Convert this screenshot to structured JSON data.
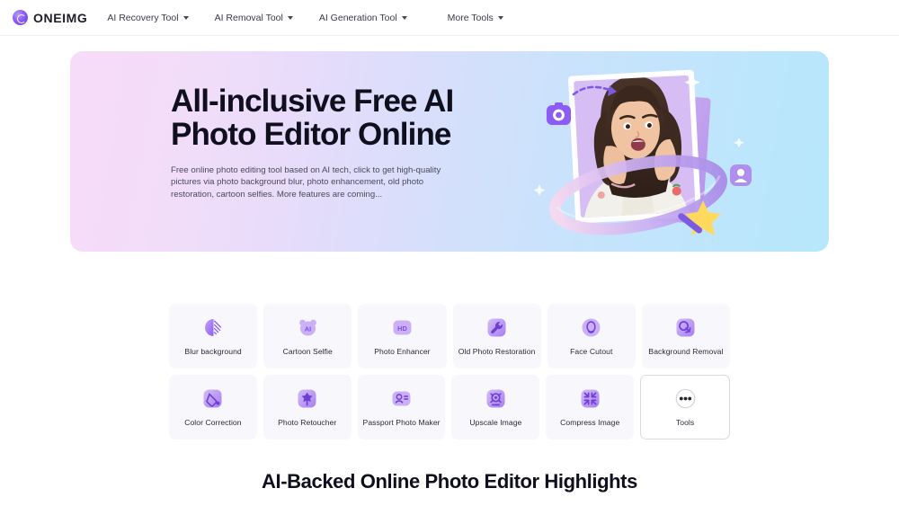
{
  "header": {
    "logo": {
      "icon": "oneimg-logo-icon",
      "text": "ONEIMG"
    },
    "nav": [
      {
        "label": "AI Recovery Tool",
        "caret": "chevron-down-icon"
      },
      {
        "label": "AI Removal Tool",
        "caret": "chevron-down-icon"
      },
      {
        "label": "AI Generation Tool",
        "caret": "chevron-down-icon"
      },
      {
        "label": "More Tools",
        "caret": "chevron-down-icon"
      }
    ]
  },
  "hero": {
    "title_line1": "All-inclusive Free AI",
    "title_line2": "Photo Editor Online",
    "subtitle": "Free online photo editing tool based on AI tech, click to get high-quality pictures via photo background blur, photo enhancement, old photo restoration, cartoon selfies. More features are coming...",
    "gradient_start": "#f7dcf8",
    "gradient_end": "#b6e7fb",
    "illustration": "woman-photo-frame-illustration"
  },
  "tools": {
    "row1": [
      {
        "label": "Blur background",
        "icon": "blur-background-icon"
      },
      {
        "label": "Cartoon Selfie",
        "icon": "cartoon-selfie-ai-icon"
      },
      {
        "label": "Photo Enhancer",
        "icon": "hd-photo-enhancer-icon"
      },
      {
        "label": "Old Photo Restoration",
        "icon": "wrench-restoration-icon"
      },
      {
        "label": "Face Cutout",
        "icon": "face-cutout-icon"
      },
      {
        "label": "Background Removal",
        "icon": "background-removal-icon"
      }
    ],
    "row2": [
      {
        "label": "Color Correction",
        "icon": "color-correction-icon"
      },
      {
        "label": "Photo Retoucher",
        "icon": "photo-retoucher-icon"
      },
      {
        "label": "Passport Photo Maker",
        "icon": "passport-photo-icon"
      },
      {
        "label": "Upscale Image",
        "icon": "upscale-image-icon"
      },
      {
        "label": "Compress Image",
        "icon": "compress-image-icon"
      },
      {
        "label": "Tools",
        "icon": "more-dots-icon"
      }
    ]
  },
  "bottom": {
    "heading": "AI-Backed Online Photo Editor Highlights"
  }
}
